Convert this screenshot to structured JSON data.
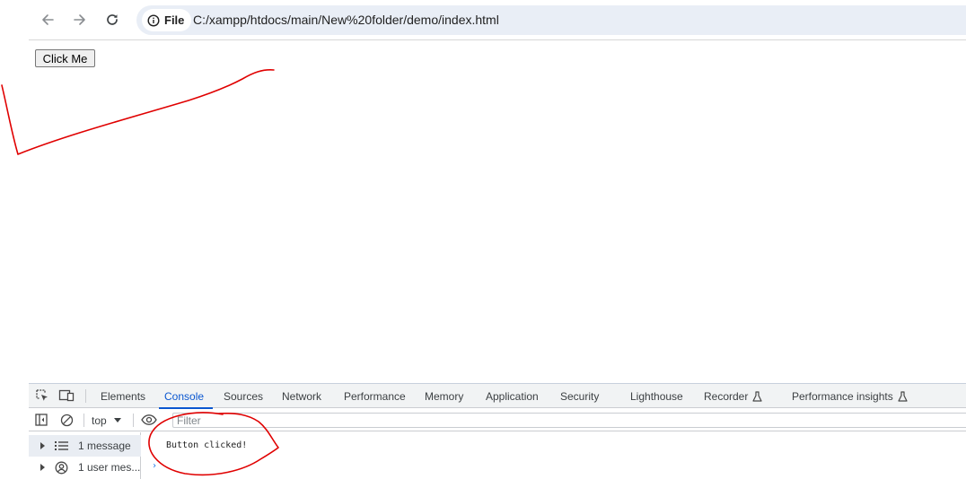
{
  "browser": {
    "site_chip_label": "File",
    "url": "C:/xampp/htdocs/main/New%20folder/demo/index.html",
    "icons": [
      "back-arrow-icon",
      "forward-arrow-icon",
      "reload-icon",
      "info-icon"
    ]
  },
  "page": {
    "button_label": "Click Me"
  },
  "devtools": {
    "tabs": [
      {
        "label": "Elements",
        "active": false
      },
      {
        "label": "Console",
        "active": true
      },
      {
        "label": "Sources",
        "active": false
      },
      {
        "label": "Network",
        "active": false
      },
      {
        "label": "Performance",
        "active": false
      },
      {
        "label": "Memory",
        "active": false
      },
      {
        "label": "Application",
        "active": false
      },
      {
        "label": "Security",
        "active": false
      },
      {
        "label": "Lighthouse",
        "active": false
      },
      {
        "label": "Recorder",
        "active": false,
        "icon": "flask-icon"
      },
      {
        "label": "Performance insights",
        "active": false,
        "icon": "flask-icon"
      }
    ],
    "console_bar": {
      "context": "top",
      "filter_placeholder": "Filter"
    },
    "sidebar": [
      {
        "label": "1 message",
        "icon": "list-icon"
      },
      {
        "label": "1 user mes...",
        "icon": "user-circle-icon"
      }
    ],
    "log": {
      "message": "Button clicked!"
    }
  },
  "colors": {
    "accent": "#0b57d0",
    "annotation_red": "#e00000",
    "omnibox_bg": "#e9eef6"
  }
}
